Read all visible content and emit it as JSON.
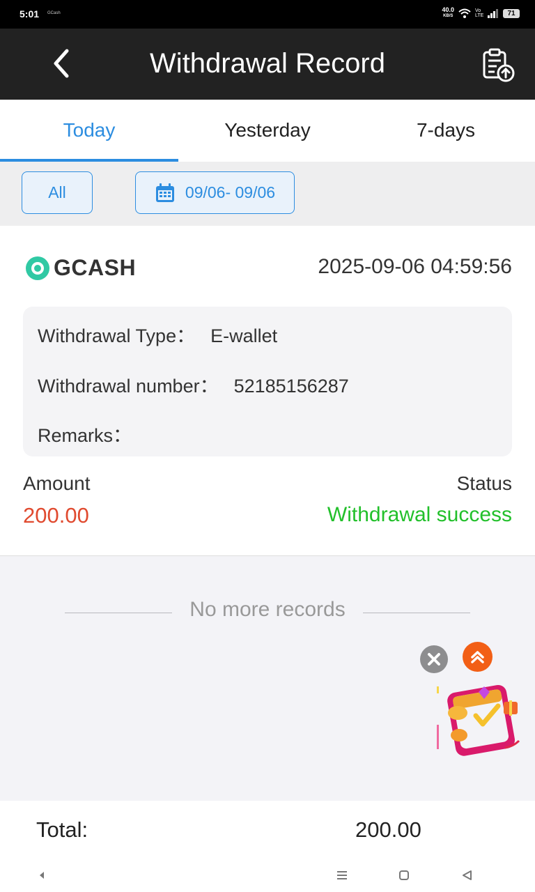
{
  "status_bar": {
    "time": "5:01",
    "notif": "GCash",
    "speed_top": "40.0",
    "speed_bottom": "KB/S",
    "signal": "Vo LTE",
    "battery": "71"
  },
  "header": {
    "title": "Withdrawal Record"
  },
  "tabs": [
    {
      "label": "Today",
      "active": true
    },
    {
      "label": "Yesterday",
      "active": false
    },
    {
      "label": "7-days",
      "active": false
    }
  ],
  "filters": {
    "all_label": "All",
    "date_range": "09/06- 09/06"
  },
  "record": {
    "provider": "GCASH",
    "datetime": "2025-09-06 04:59:56",
    "type_label": "Withdrawal Type：",
    "type_value": "E-wallet",
    "number_label": "Withdrawal number：",
    "number_value": "52185156287",
    "remarks_label": "Remarks：",
    "remarks_value": "",
    "amount_label": "Amount",
    "amount_value": "200.00",
    "status_label": "Status",
    "status_value": "Withdrawal success"
  },
  "list_end_text": "No more records",
  "footer": {
    "total_label": "Total:",
    "total_value": "200.00"
  },
  "colors": {
    "accent": "#2c8de0",
    "amount": "#e04a2f",
    "success": "#22c02b",
    "header_bg": "#222222"
  }
}
